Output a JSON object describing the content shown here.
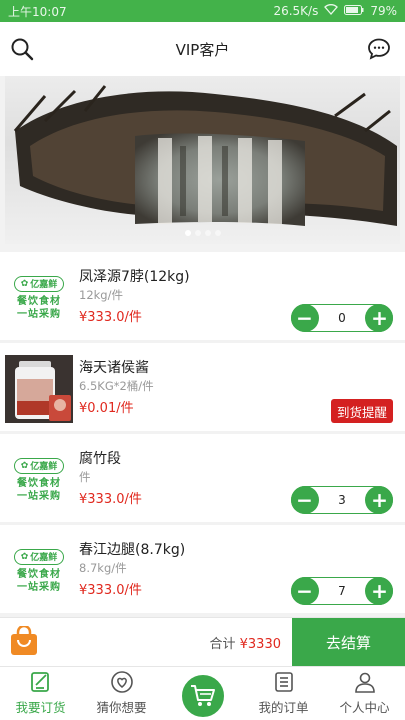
{
  "status_bar": {
    "time": "上午10:07",
    "speed": "26.5K/s",
    "battery": "79%"
  },
  "header": {
    "title": "VIP客户",
    "search_icon": "search-icon",
    "message_icon": "chat-icon"
  },
  "banner": {
    "slide_count": 4,
    "active_slide": 1
  },
  "products": [
    {
      "name": "凤泽源7脖(12kg)",
      "spec": "12kg/件",
      "price": "¥333.0/件",
      "qty": "0",
      "thumb": "logo",
      "action": "stepper"
    },
    {
      "name": "海天诸侯酱",
      "spec": "6.5KG*2桶/件",
      "price": "¥0.01/件",
      "action": "notify",
      "notify_label": "到货提醒",
      "thumb": "photo"
    },
    {
      "name": "腐竹段",
      "spec": "件",
      "price": "¥333.0/件",
      "qty": "3",
      "thumb": "logo",
      "action": "stepper"
    },
    {
      "name": "春江边腿(8.7kg)",
      "spec": "8.7kg/件",
      "price": "¥333.0/件",
      "qty": "7",
      "thumb": "logo",
      "action": "stepper"
    }
  ],
  "logo": {
    "brand": "亿嘉鲜",
    "line1": "餐饮食材",
    "line2": "一站采购"
  },
  "cart": {
    "total_label": "合计",
    "total_amount": "¥3330",
    "checkout_label": "去结算"
  },
  "tabs": [
    {
      "label": "我要订货",
      "icon": "order-edit-icon"
    },
    {
      "label": "猜你想要",
      "icon": "heart-icon"
    },
    {
      "label": "",
      "icon": "cart-icon"
    },
    {
      "label": "我的订单",
      "icon": "order-list-icon"
    },
    {
      "label": "个人中心",
      "icon": "user-icon"
    }
  ],
  "colors": {
    "accent": "#3aa84a",
    "price": "#e0281e",
    "notify": "#d42121"
  }
}
